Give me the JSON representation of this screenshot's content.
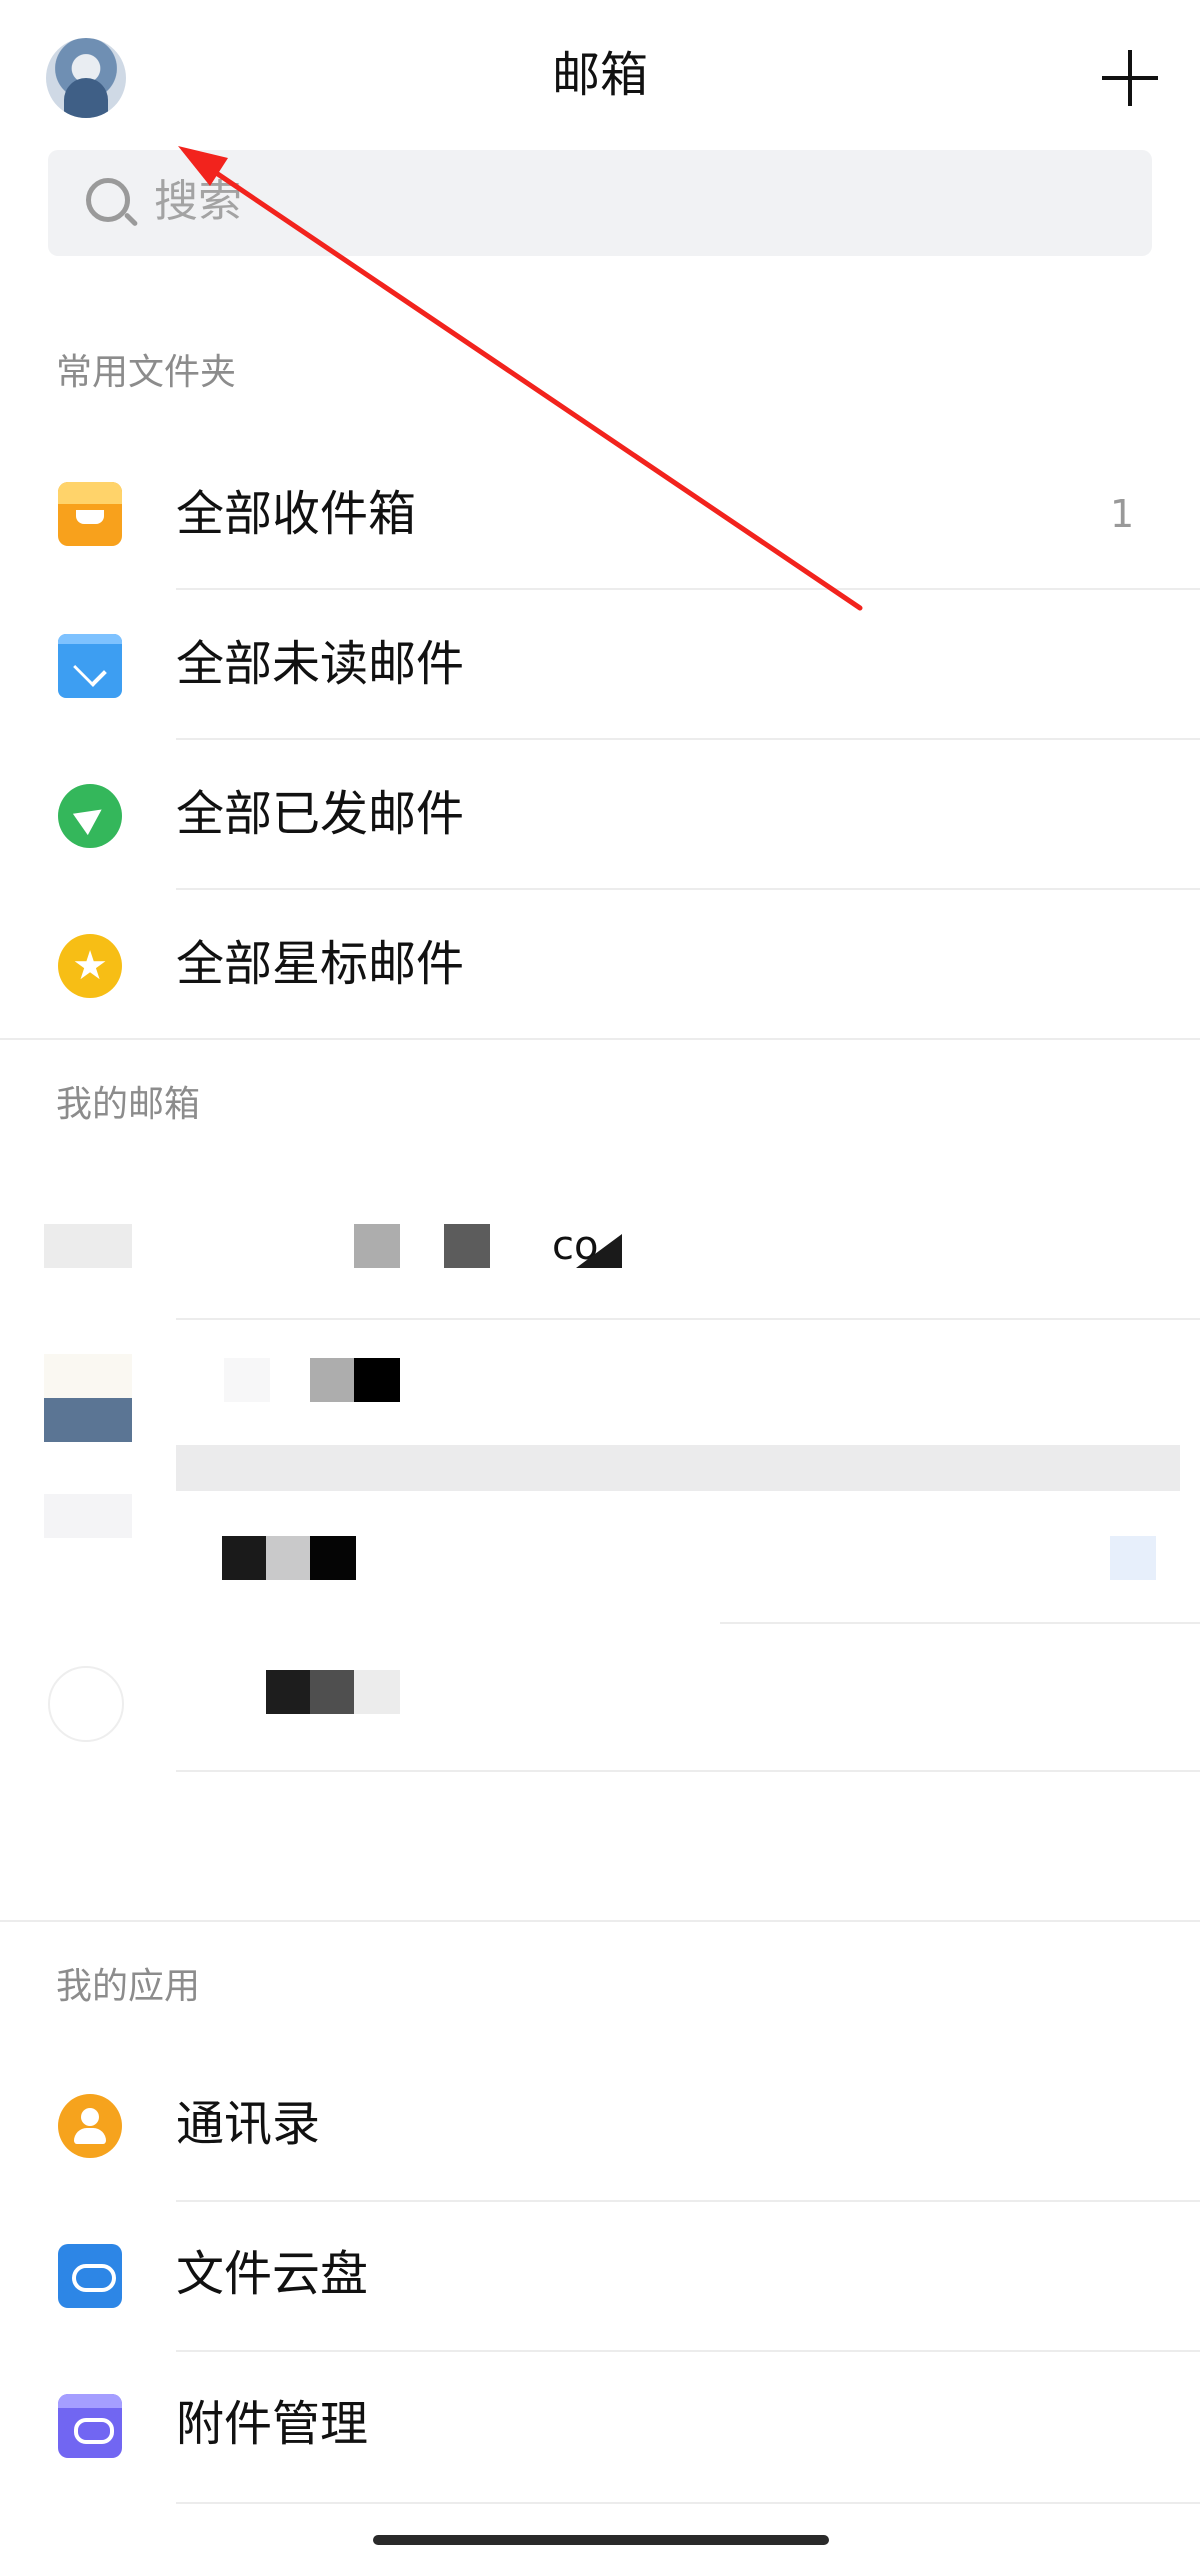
{
  "header": {
    "title": "邮箱",
    "add_icon": "plus-icon",
    "avatar_icon": "user-avatar"
  },
  "search": {
    "placeholder": "搜索",
    "icon": "search-icon"
  },
  "common_folders": {
    "section_title": "常用文件夹",
    "items": [
      {
        "label": "全部收件箱",
        "icon": "inbox-icon",
        "count": "1"
      },
      {
        "label": "全部未读邮件",
        "icon": "unread-mail-icon"
      },
      {
        "label": "全部已发邮件",
        "icon": "sent-mail-icon"
      },
      {
        "label": "全部星标邮件",
        "icon": "star-icon"
      }
    ]
  },
  "my_mailboxes": {
    "section_title": "我的邮箱",
    "accounts_visible_fragment": "co"
  },
  "my_apps": {
    "section_title": "我的应用",
    "items": [
      {
        "label": "通讯录",
        "icon": "contacts-icon"
      },
      {
        "label": "文件云盘",
        "icon": "cloud-drive-icon"
      },
      {
        "label": "附件管理",
        "icon": "attachment-icon"
      }
    ]
  },
  "colors": {
    "annotation_arrow": "#f2231d",
    "divider": "#ececec",
    "section_text": "#8c8c8c"
  }
}
